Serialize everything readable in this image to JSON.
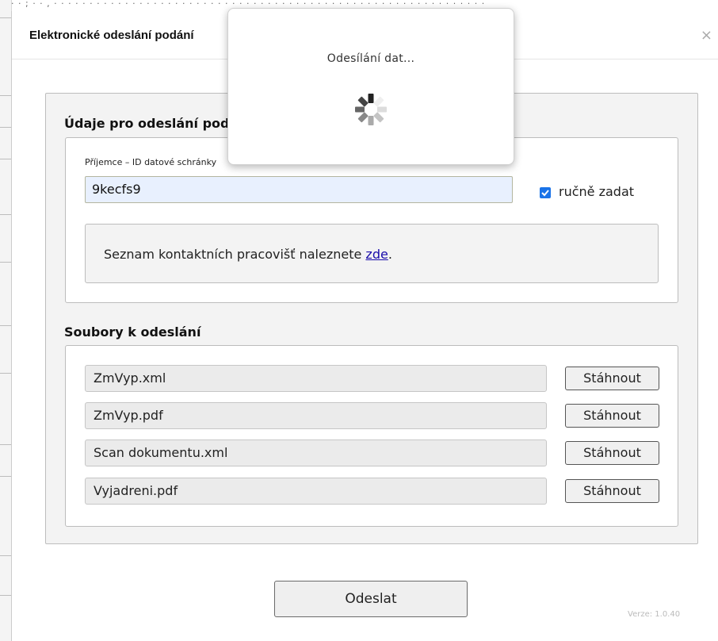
{
  "modal": {
    "title": "Elektronické odeslání podání",
    "close_glyph": "×"
  },
  "recipient_section": {
    "title": "Údaje pro odeslání podání",
    "field_label": "Příjemce – ID datové schránky",
    "field_value": "9kecfs9",
    "manual_checkbox": {
      "label": "ručně zadat",
      "checked": true
    },
    "info_text": "Seznam kontaktních pracovišť naleznete ",
    "info_link": "zde",
    "info_suffix": "."
  },
  "files_section": {
    "title": "Soubory k odeslání",
    "download_label": "Stáhnout",
    "files": [
      "ZmVyp.xml",
      "ZmVyp.pdf",
      "Scan dokumentu.xml",
      "Vyjadreni.pdf"
    ]
  },
  "send_button": "Odeslat",
  "version": "Verze: 1.0.40",
  "loading": {
    "text": "Odesílání dat...",
    "icon": "spinner-icon"
  },
  "colors": {
    "checkbox": "#1a73e8",
    "link": "#1a0dab",
    "input_bg": "#e8f0fe",
    "panel_bg": "#f3f3f3"
  }
}
